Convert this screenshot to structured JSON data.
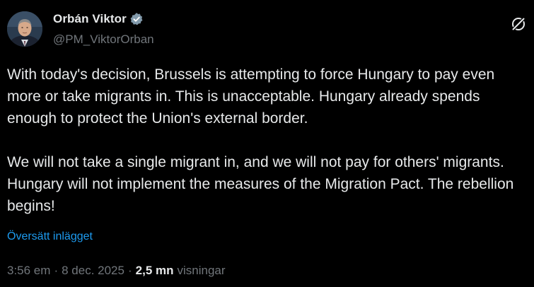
{
  "author": {
    "display_name": "Orbán Viktor",
    "handle": "@PM_ViktorOrban",
    "verified_icon": "verified-badge-icon",
    "avatar": "avatar-photo"
  },
  "header": {
    "grok_icon": "grok-icon"
  },
  "tweet": {
    "paragraphs": [
      "With today's decision, Brussels is attempting to force Hungary to pay even more or take migrants in. This is unacceptable. Hungary already spends enough to protect the Union's external border.",
      "We will not take a single migrant in, and we will not pay for others' migrants. Hungary will not implement the measures of the Migration Pact. The rebellion begins!"
    ],
    "translate_label": "Översätt inlägget"
  },
  "meta": {
    "time": "3:56 em",
    "separator": "·",
    "date": "8 dec. 2025",
    "views_count": "2,5 mn",
    "views_label": "visningar"
  },
  "colors": {
    "background": "#000000",
    "text_primary": "#e7e9ea",
    "text_secondary": "#71767b",
    "link": "#1d9bf0",
    "verified_badge": "#829aab"
  }
}
